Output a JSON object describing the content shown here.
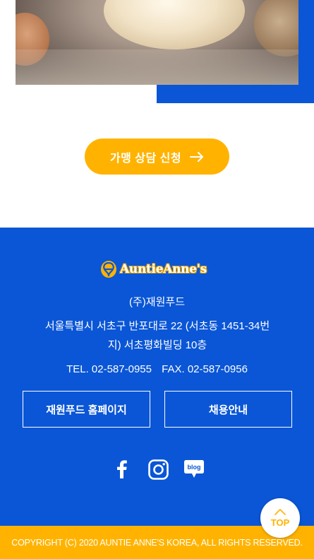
{
  "hero": {
    "image_alt": "dough-photo"
  },
  "cta": {
    "label": "가맹 상담 신청",
    "icon": "arrow-right-icon"
  },
  "footer": {
    "logo_text": "AuntieAnne's",
    "company": "(주)재원푸드",
    "address": "서울특별시 서초구 반포대로 22 (서초동 1451-34번지) 서초평화빌딩 10층",
    "tel": "TEL. 02-587-0955",
    "fax": "FAX. 02-587-0956",
    "buttons": {
      "homepage": "재원푸드 홈페이지",
      "recruit": "채용안내"
    },
    "social": {
      "facebook": "facebook-icon",
      "instagram": "instagram-icon",
      "blog_text": "blog"
    },
    "copyright": "COPYRIGHT (C) 2020 AUNTIE ANNE'S KOREA, ALL RIGHTS RESERVED."
  },
  "top_button": {
    "label": "TOP"
  },
  "colors": {
    "brand_blue": "#0a56d6",
    "accent_yellow": "#ffb300",
    "white": "#ffffff"
  }
}
